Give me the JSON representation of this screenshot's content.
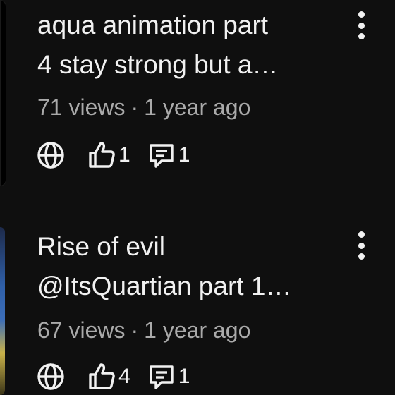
{
  "videos": [
    {
      "title": "aqua animation part\n4 stay strong but a…",
      "views": "71 views",
      "separator": "·",
      "age": "1 year ago",
      "likes": "1",
      "comments": "1"
    },
    {
      "title": "Rise of evil\n@ItsQuartian part 1…",
      "views": "67 views",
      "separator": "·",
      "age": "1 year ago",
      "likes": "4",
      "comments": "1"
    }
  ],
  "icons": {
    "visibility": "globe-icon",
    "like": "thumbs-up-icon",
    "comment": "comment-icon",
    "menu": "more-vert-icon"
  },
  "colors": {
    "background": "#0f0f0f",
    "text": "#f1f1f1",
    "secondary_text": "#aaaaaa"
  }
}
